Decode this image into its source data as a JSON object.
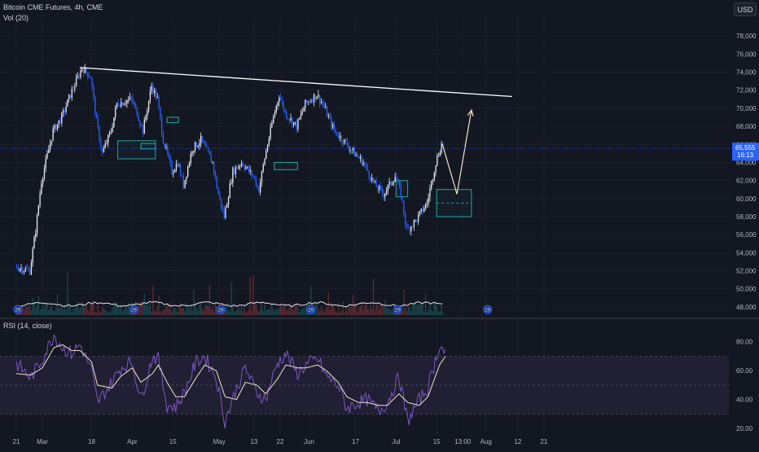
{
  "header": {
    "main_title": "Bitcoin CME Futures, 4h, CME",
    "volume_label": "Vol (20)",
    "rsi_title": "RSI (14, close)",
    "currency_button": "USD"
  },
  "colors": {
    "background": "#131722",
    "up": "#26a69a",
    "down": "#ef5350",
    "candle_blue": "#2962ff",
    "trendline": "#ffffff",
    "projection": "#f0e6c0",
    "zone": "#26a69a",
    "rsi_line": "#7e57c2",
    "rsi_ma": "#f0e6c0",
    "rsi_fill": "#2a2440",
    "price_tag": "#2962ff"
  },
  "chart_data": [
    {
      "type": "candlestick",
      "title": "Bitcoin CME Futures, 4h, CME",
      "ylim": [
        47000,
        80000
      ],
      "y_ticks": [
        "48,000",
        "50,000",
        "52,000",
        "54,000",
        "56,000",
        "58,000",
        "60,000",
        "62,000",
        "64,000",
        "66,000",
        "68,000",
        "70,000",
        "72,000",
        "74,000",
        "76,000",
        "78,000"
      ],
      "x_ticks": [
        "21",
        "Mar",
        "18",
        "Apr",
        "15",
        "May",
        "13",
        "22",
        "Jun",
        "17",
        "Jul",
        "15",
        "13:00",
        "Aug",
        "12",
        "21"
      ],
      "last_price": "65,555",
      "countdown": "16:13",
      "price_path": {
        "x": [
          "Feb 21",
          "Feb 26",
          "Feb 28",
          "Mar 1",
          "Mar 5",
          "Mar 8",
          "Mar 11",
          "Mar 13",
          "Mar 15",
          "Mar 18",
          "Mar 20",
          "Mar 22",
          "Mar 25",
          "Mar 27",
          "Apr 1",
          "Apr 3",
          "Apr 5",
          "Apr 8",
          "Apr 10",
          "Apr 12",
          "Apr 15",
          "Apr 17",
          "Apr 19",
          "Apr 22",
          "Apr 25",
          "Apr 29",
          "May 1",
          "May 3",
          "May 6",
          "May 9",
          "May 13",
          "May 15",
          "May 17",
          "May 20",
          "May 22",
          "May 24",
          "May 28",
          "May 31",
          "Jun 4",
          "Jun 6",
          "Jun 10",
          "Jun 13",
          "Jun 17",
          "Jun 20",
          "Jun 24",
          "Jun 27",
          "Jul 1",
          "Jul 3",
          "Jul 5",
          "Jul 8",
          "Jul 10",
          "Jul 12",
          "Jul 15",
          "Jul 17"
        ],
        "close": [
          52500,
          52000,
          56500,
          62000,
          67500,
          69000,
          71500,
          73000,
          74500,
          73500,
          68500,
          65000,
          67500,
          70500,
          71000,
          69500,
          67500,
          72500,
          71000,
          66500,
          63000,
          64000,
          61500,
          65500,
          66500,
          64000,
          60500,
          58000,
          63000,
          64000,
          62500,
          61000,
          64500,
          69000,
          71500,
          69500,
          68000,
          70500,
          71500,
          70500,
          67500,
          66500,
          65000,
          64000,
          61500,
          60500,
          62500,
          60500,
          56500,
          57500,
          58500,
          59500,
          64000,
          66000
        ]
      },
      "volume_axis_label": "29",
      "annotations": {
        "trendline": {
          "from": {
            "x": "Mar 14",
            "y": 74500
          },
          "to": {
            "x": "Aug 10",
            "y": 71300
          }
        },
        "projection": [
          {
            "x": "Jul 17",
            "y": 66000
          },
          {
            "x": "Jul 22",
            "y": 60500
          },
          {
            "x": "Jul 27",
            "y": 69800
          }
        ],
        "zones": [
          {
            "x0": "Mar 27",
            "x1": "Apr 9",
            "y0": 64400,
            "y1": 66400
          },
          {
            "x0": "Apr 4",
            "x1": "Apr 9",
            "y0": 65500,
            "y1": 66100
          },
          {
            "x0": "Apr 13",
            "x1": "Apr 17",
            "y0": 68400,
            "y1": 69000
          },
          {
            "x0": "May 20",
            "x1": "May 28",
            "y0": 63200,
            "y1": 64000
          },
          {
            "x0": "Jul 1",
            "x1": "Jul 5",
            "y0": 60200,
            "y1": 62000
          },
          {
            "x0": "Jul 15",
            "x1": "Jul 27",
            "y0": 58000,
            "y1": 61000
          }
        ]
      }
    },
    {
      "type": "line",
      "title": "RSI (14, close)",
      "ylim": [
        15,
        90
      ],
      "y_ticks": [
        "20.00",
        "40.00",
        "60.00",
        "80.00"
      ],
      "bands": [
        30,
        50,
        70
      ],
      "x": [
        "Feb 21",
        "Feb 26",
        "Mar 1",
        "Mar 5",
        "Mar 8",
        "Mar 11",
        "Mar 14",
        "Mar 18",
        "Mar 20",
        "Mar 25",
        "Mar 28",
        "Apr 1",
        "Apr 4",
        "Apr 8",
        "Apr 10",
        "Apr 13",
        "Apr 16",
        "Apr 19",
        "Apr 23",
        "Apr 26",
        "Apr 30",
        "May 3",
        "May 7",
        "May 10",
        "May 14",
        "May 17",
        "May 21",
        "May 24",
        "May 28",
        "May 31",
        "Jun 4",
        "Jun 7",
        "Jun 11",
        "Jun 14",
        "Jun 18",
        "Jun 21",
        "Jun 25",
        "Jun 28",
        "Jul 2",
        "Jul 5",
        "Jul 9",
        "Jul 12",
        "Jul 16",
        "Jul 18"
      ],
      "rsi": [
        65,
        55,
        68,
        85,
        76,
        72,
        78,
        60,
        38,
        52,
        62,
        66,
        40,
        70,
        68,
        36,
        35,
        45,
        66,
        70,
        55,
        25,
        48,
        62,
        45,
        40,
        65,
        72,
        58,
        64,
        68,
        56,
        50,
        34,
        38,
        40,
        32,
        38,
        56,
        25,
        40,
        48,
        78,
        72
      ],
      "rsi_ma": [
        58,
        57,
        62,
        76,
        78,
        74,
        74,
        66,
        50,
        48,
        56,
        62,
        52,
        58,
        64,
        52,
        42,
        42,
        55,
        64,
        60,
        42,
        40,
        52,
        50,
        44,
        54,
        64,
        62,
        62,
        64,
        60,
        52,
        42,
        38,
        38,
        36,
        36,
        44,
        38,
        36,
        42,
        64,
        70
      ]
    }
  ]
}
